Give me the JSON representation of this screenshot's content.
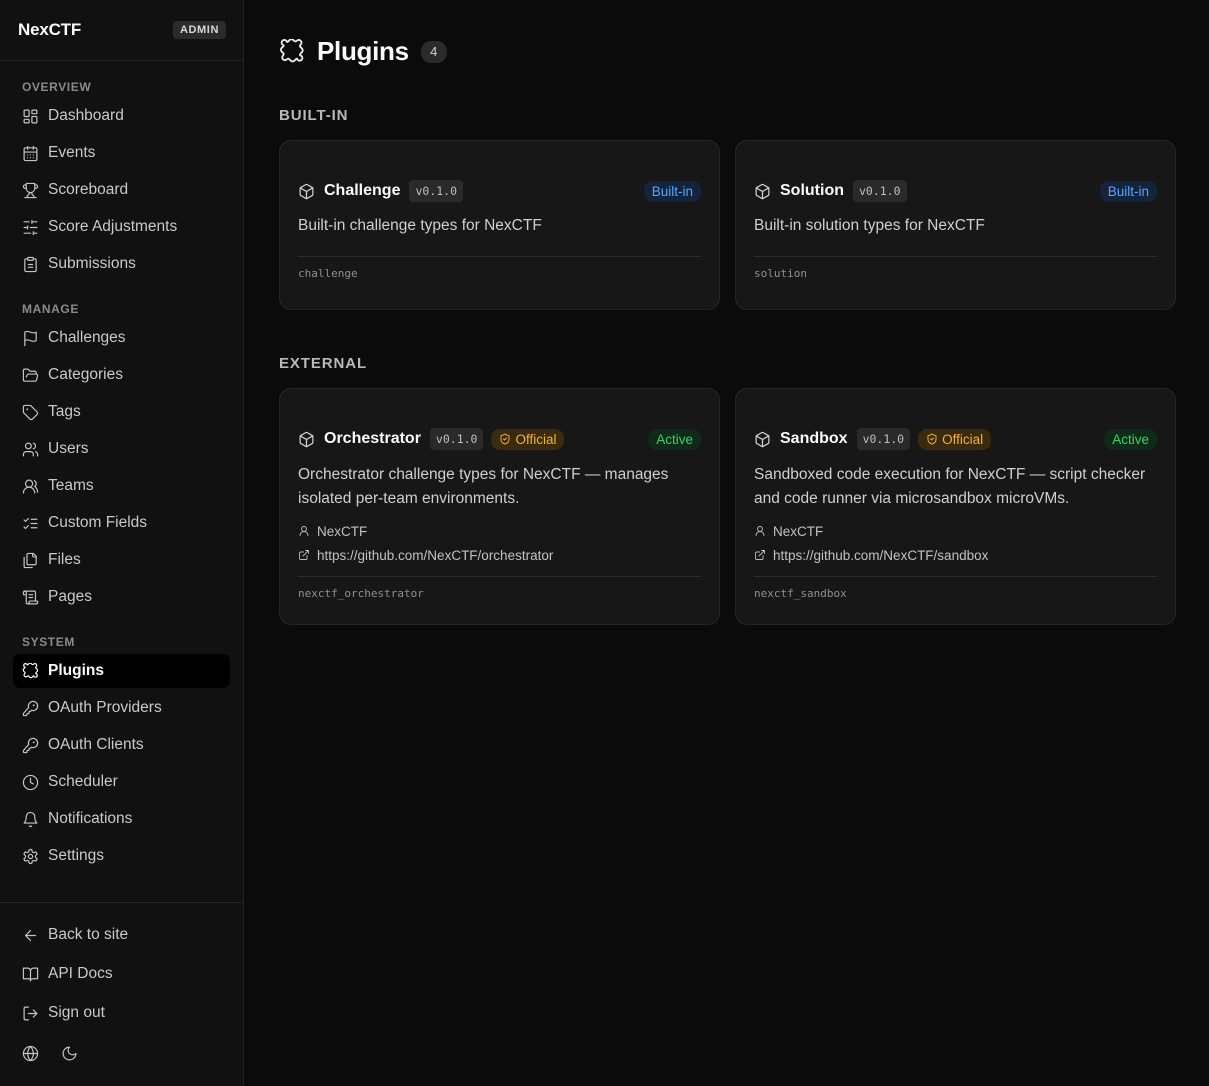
{
  "sidebar": {
    "brand": "NexCTF",
    "badge": "ADMIN",
    "sections": {
      "overview": "OVERVIEW",
      "manage": "MANAGE",
      "system": "SYSTEM"
    },
    "items": {
      "dashboard": "Dashboard",
      "events": "Events",
      "scoreboard": "Scoreboard",
      "score_adjustments": "Score Adjustments",
      "submissions": "Submissions",
      "challenges": "Challenges",
      "categories": "Categories",
      "tags": "Tags",
      "users": "Users",
      "teams": "Teams",
      "custom_fields": "Custom Fields",
      "files": "Files",
      "pages": "Pages",
      "plugins": "Plugins",
      "oauth_providers": "OAuth Providers",
      "oauth_clients": "OAuth Clients",
      "scheduler": "Scheduler",
      "notifications": "Notifications",
      "settings": "Settings"
    },
    "footer": {
      "back": "Back to site",
      "api_docs": "API Docs",
      "sign_out": "Sign out"
    }
  },
  "page": {
    "title": "Plugins",
    "count": "4",
    "sections": {
      "builtin": "BUILT-IN",
      "external": "EXTERNAL"
    }
  },
  "plugins": {
    "challenge": {
      "name": "Challenge",
      "version": "v0.1.0",
      "status": "Built-in",
      "description": "Built-in challenge types for NexCTF",
      "id": "challenge"
    },
    "solution": {
      "name": "Solution",
      "version": "v0.1.0",
      "status": "Built-in",
      "description": "Built-in solution types for NexCTF",
      "id": "solution"
    },
    "orchestrator": {
      "name": "Orchestrator",
      "version": "v0.1.0",
      "official": "Official",
      "status": "Active",
      "description": "Orchestrator challenge types for NexCTF — manages isolated per-team environments.",
      "author": "NexCTF",
      "url": "https://github.com/NexCTF/orchestrator",
      "id": "nexctf_orchestrator"
    },
    "sandbox": {
      "name": "Sandbox",
      "version": "v0.1.0",
      "official": "Official",
      "status": "Active",
      "description": "Sandboxed code execution for NexCTF — script checker and code runner via microsandbox microVMs.",
      "author": "NexCTF",
      "url": "https://github.com/NexCTF/sandbox",
      "id": "nexctf_sandbox"
    }
  },
  "colors": {
    "builtin": "#5aa2ff",
    "active": "#39d06a",
    "official": "#f2b233"
  }
}
